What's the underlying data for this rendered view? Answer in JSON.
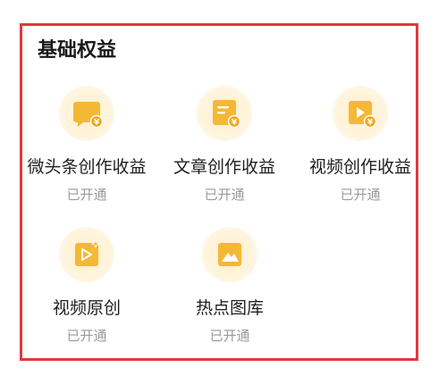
{
  "section": {
    "title": "基础权益"
  },
  "benefits": [
    {
      "label": "微头条创作收益",
      "status": "已开通",
      "icon": "micro-post-income-icon"
    },
    {
      "label": "文章创作收益",
      "status": "已开通",
      "icon": "article-income-icon"
    },
    {
      "label": "视频创作收益",
      "status": "已开通",
      "icon": "video-income-icon"
    },
    {
      "label": "视频原创",
      "status": "已开通",
      "icon": "video-original-icon"
    },
    {
      "label": "热点图库",
      "status": "已开通",
      "icon": "hot-gallery-icon"
    }
  ],
  "colors": {
    "accent": "#f5b835",
    "frame": "#e0393e",
    "status_text": "#9a9a9a"
  }
}
